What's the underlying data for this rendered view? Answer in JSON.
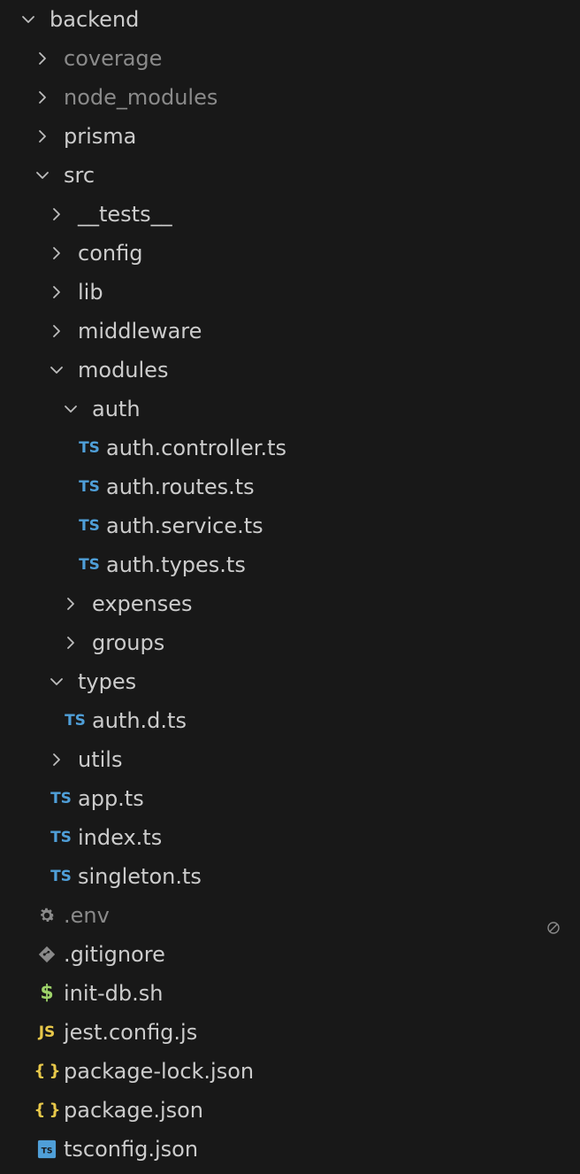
{
  "tree": [
    {
      "label": "backend",
      "kind": "folder",
      "open": true,
      "depth": 0,
      "dim": false
    },
    {
      "label": "coverage",
      "kind": "folder",
      "open": false,
      "depth": 1,
      "dim": true
    },
    {
      "label": "node_modules",
      "kind": "folder",
      "open": false,
      "depth": 1,
      "dim": true
    },
    {
      "label": "prisma",
      "kind": "folder",
      "open": false,
      "depth": 1,
      "dim": false
    },
    {
      "label": "src",
      "kind": "folder",
      "open": true,
      "depth": 1,
      "dim": false
    },
    {
      "label": "__tests__",
      "kind": "folder",
      "open": false,
      "depth": 2,
      "dim": false
    },
    {
      "label": "config",
      "kind": "folder",
      "open": false,
      "depth": 2,
      "dim": false
    },
    {
      "label": "lib",
      "kind": "folder",
      "open": false,
      "depth": 2,
      "dim": false
    },
    {
      "label": "middleware",
      "kind": "folder",
      "open": false,
      "depth": 2,
      "dim": false
    },
    {
      "label": "modules",
      "kind": "folder",
      "open": true,
      "depth": 2,
      "dim": false
    },
    {
      "label": "auth",
      "kind": "folder",
      "open": true,
      "depth": 3,
      "dim": false
    },
    {
      "label": "auth.controller.ts",
      "kind": "ts",
      "depth": 4,
      "icon": "TS"
    },
    {
      "label": "auth.routes.ts",
      "kind": "ts",
      "depth": 4,
      "icon": "TS"
    },
    {
      "label": "auth.service.ts",
      "kind": "ts",
      "depth": 4,
      "icon": "TS"
    },
    {
      "label": "auth.types.ts",
      "kind": "ts",
      "depth": 4,
      "icon": "TS"
    },
    {
      "label": "expenses",
      "kind": "folder",
      "open": false,
      "depth": 3,
      "dim": false
    },
    {
      "label": "groups",
      "kind": "folder",
      "open": false,
      "depth": 3,
      "dim": false
    },
    {
      "label": "types",
      "kind": "folder",
      "open": true,
      "depth": 2,
      "dim": false
    },
    {
      "label": "auth.d.ts",
      "kind": "ts",
      "depth": 3,
      "icon": "TS"
    },
    {
      "label": "utils",
      "kind": "folder",
      "open": false,
      "depth": 2,
      "dim": false
    },
    {
      "label": "app.ts",
      "kind": "ts",
      "depth": 2,
      "icon": "TS"
    },
    {
      "label": "index.ts",
      "kind": "ts",
      "depth": 2,
      "icon": "TS"
    },
    {
      "label": "singleton.ts",
      "kind": "ts",
      "depth": 2,
      "icon": "TS"
    },
    {
      "label": ".env",
      "kind": "env",
      "depth": 1,
      "dim": true,
      "icon": "gear-icon",
      "badge": "ignored-icon"
    },
    {
      "label": ".gitignore",
      "kind": "git",
      "depth": 1,
      "icon": "git-icon"
    },
    {
      "label": "init-db.sh",
      "kind": "sh",
      "depth": 1,
      "icon": "$"
    },
    {
      "label": "jest.config.js",
      "kind": "js",
      "depth": 1,
      "icon": "JS"
    },
    {
      "label": "package-lock.json",
      "kind": "json",
      "depth": 1,
      "icon": "{ }"
    },
    {
      "label": "package.json",
      "kind": "json",
      "depth": 1,
      "icon": "{ }"
    },
    {
      "label": "tsconfig.json",
      "kind": "tsconf",
      "depth": 1,
      "icon": "tsconfig-icon"
    }
  ],
  "colors": {
    "background": "#181818",
    "text": "#cccccc",
    "dim": "#8a8a8a",
    "ts": "#4f9fd8",
    "json": "#e8c84a",
    "sh": "#9ed36a"
  }
}
